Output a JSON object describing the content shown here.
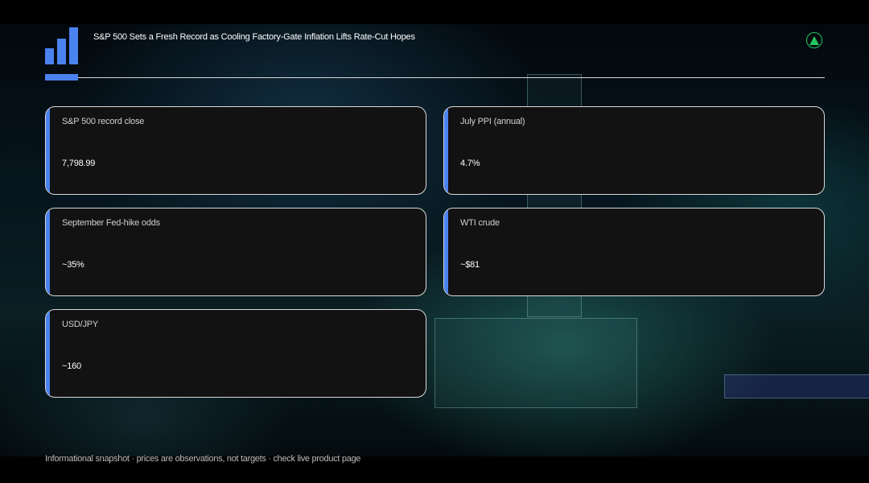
{
  "header": {
    "headline": "S&P 500 Sets a Fresh Record as Cooling Factory-Gate Inflation Lifts Rate-Cut Hopes",
    "logo_icon": "bar-chart-logo-icon",
    "status_icon": "up-arrow-circle-icon",
    "status_color": "#22c55e"
  },
  "accent_color": "#4a82f0",
  "cards": [
    {
      "label": "S&P 500 record close",
      "value": "7,798.99"
    },
    {
      "label": "July PPI (annual)",
      "value": "4.7%"
    },
    {
      "label": "September Fed-hike odds",
      "value": "~35%"
    },
    {
      "label": "WTI crude",
      "value": "~$81"
    },
    {
      "label": "USD/JPY",
      "value": "~160"
    }
  ],
  "footer": {
    "disclaimer": "Informational snapshot · prices are observations, not targets · check live product page"
  }
}
